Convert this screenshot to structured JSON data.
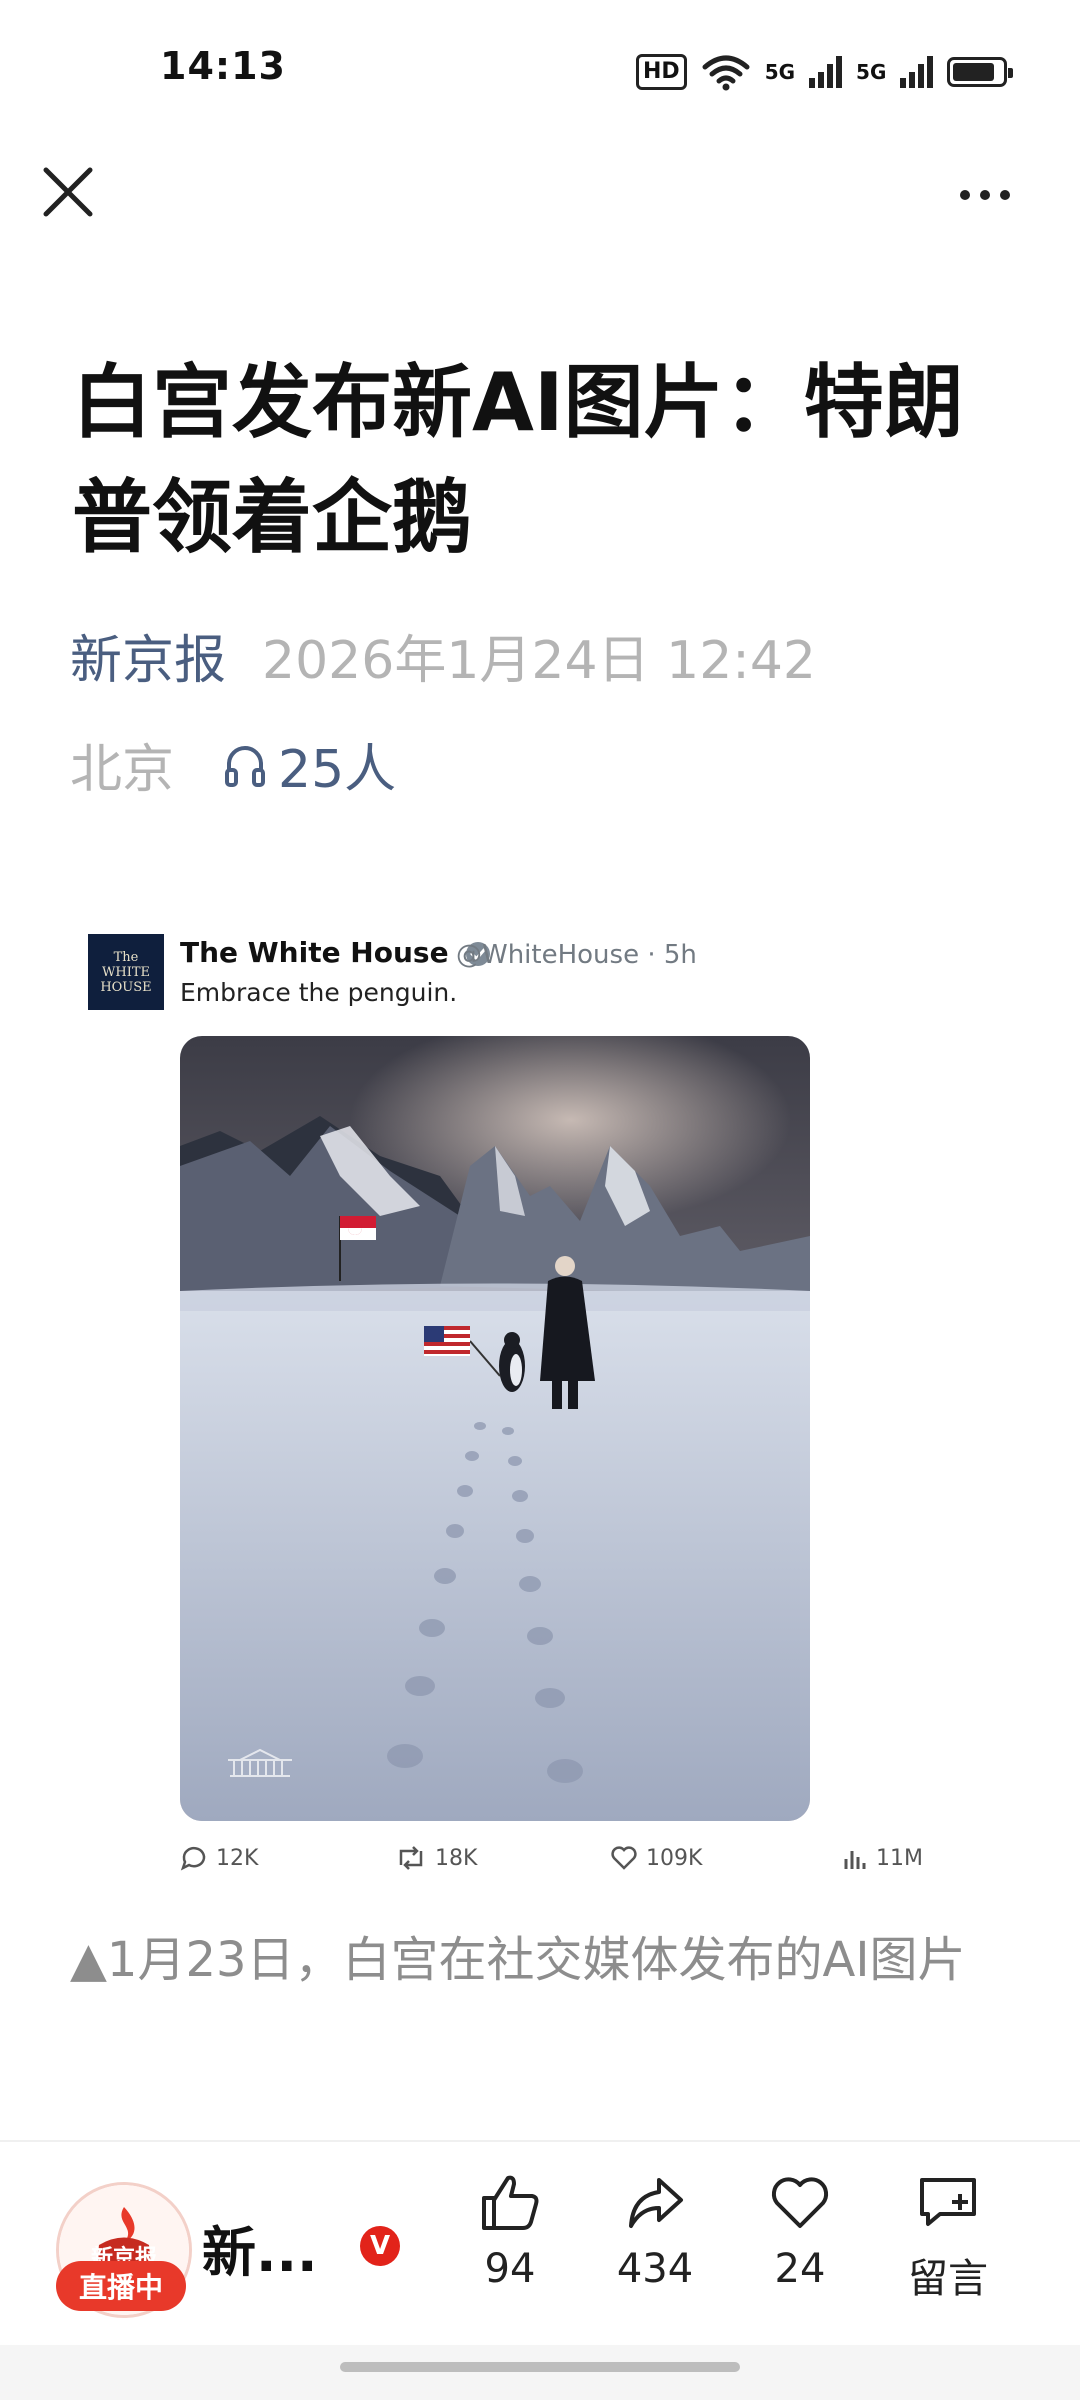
{
  "status_bar": {
    "time": "14:13",
    "hd": "HD",
    "network1": "5G",
    "network2": "5G",
    "battery_level": 0.75
  },
  "nav": {
    "close_icon": "close-icon",
    "more_icon": "more-icon"
  },
  "article": {
    "title": "白宫发布新AI图片：特朗普领着企鹅",
    "source": "新京报",
    "date": "2026年1月24日 12:42",
    "location": "北京",
    "listeners": "25人",
    "caption": "▲1月23日，白宫在社交媒体发布的AI图片"
  },
  "embed": {
    "logo_text": [
      "The",
      "WHITE",
      "HOUSE"
    ],
    "name": "The White House",
    "handle": "@WhiteHouse · 5h",
    "text": "Embrace the penguin.",
    "replies": "12K",
    "reposts": "18K",
    "likes": "109K",
    "views": "11M"
  },
  "bottom_bar": {
    "avatar_text": "新京报",
    "live_label": "直播中",
    "account_name": "新...",
    "verified": "V",
    "like_count": "94",
    "share_count": "434",
    "favorite_count": "24",
    "comment_label": "留言"
  },
  "colors": {
    "source_blue": "#4a5e80",
    "meta_gray": "#b4b4b4",
    "live_red": "#e8392a",
    "verified_red": "#e2231a"
  }
}
